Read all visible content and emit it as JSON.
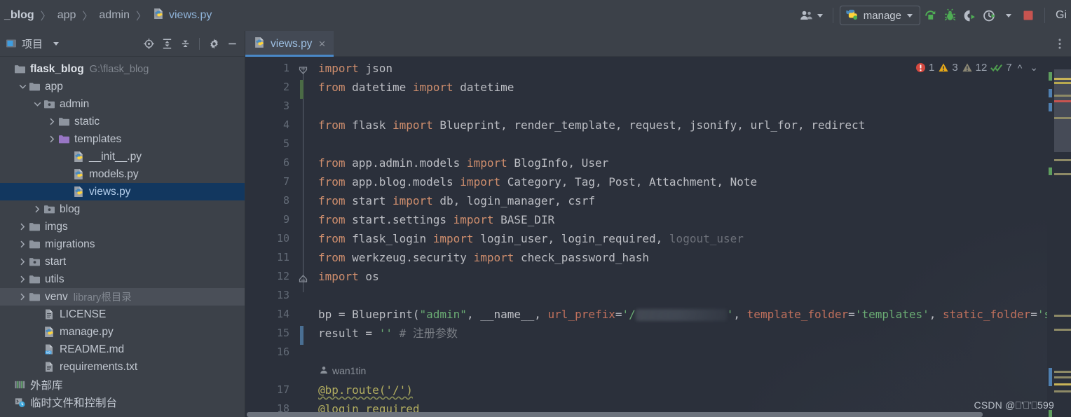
{
  "breadcrumb": {
    "items": [
      {
        "label": "_blog",
        "type": "root"
      },
      {
        "label": "app",
        "type": "dir"
      },
      {
        "label": "admin",
        "type": "dir"
      },
      {
        "label": "views.py",
        "type": "file"
      }
    ],
    "separator": "〉"
  },
  "toolbar": {
    "user_icon": "people-icon",
    "run_config": {
      "label": "manage",
      "icon": "python-icon",
      "caret": "▾"
    },
    "buttons": [
      {
        "name": "run-button",
        "icon": "run-arrow-icon"
      },
      {
        "name": "debug-button",
        "icon": "bug-icon"
      },
      {
        "name": "run-with-coverage-button",
        "icon": "coverage-icon"
      },
      {
        "name": "profile-button",
        "icon": "profile-clock-icon"
      },
      {
        "name": "stop-button",
        "icon": "stop-square-icon"
      }
    ],
    "git_label": "Gi"
  },
  "project_panel": {
    "title": "项目",
    "title_caret": "▾",
    "tools": [
      {
        "name": "select-opened-file-icon",
        "title": "locate"
      },
      {
        "name": "expand-all-icon",
        "title": "expand all"
      },
      {
        "name": "collapse-all-icon",
        "title": "collapse all"
      },
      {
        "name": "gear-icon",
        "title": "settings"
      },
      {
        "name": "hide-panel-icon",
        "title": "hide"
      }
    ]
  },
  "tree": [
    {
      "label": "flask_blog",
      "sub": "G:\\flask_blog",
      "indent": 0,
      "arrow": "none",
      "icon": "folder-icon",
      "state": "root"
    },
    {
      "label": "app",
      "sub": "",
      "indent": 1,
      "arrow": "down",
      "icon": "folder-icon",
      "state": "normal"
    },
    {
      "label": "admin",
      "sub": "",
      "indent": 2,
      "arrow": "down",
      "icon": "package-icon",
      "state": "normal"
    },
    {
      "label": "static",
      "sub": "",
      "indent": 3,
      "arrow": "right",
      "icon": "folder-icon",
      "state": "normal"
    },
    {
      "label": "templates",
      "sub": "",
      "indent": 3,
      "arrow": "right",
      "icon": "templates-folder-icon",
      "state": "normal"
    },
    {
      "label": "__init__.py",
      "sub": "",
      "indent": 4,
      "arrow": "none",
      "icon": "python-file-icon",
      "state": "normal"
    },
    {
      "label": "models.py",
      "sub": "",
      "indent": 4,
      "arrow": "none",
      "icon": "python-file-icon",
      "state": "normal"
    },
    {
      "label": "views.py",
      "sub": "",
      "indent": 4,
      "arrow": "none",
      "icon": "python-file-icon",
      "state": "selected"
    },
    {
      "label": "blog",
      "sub": "",
      "indent": 2,
      "arrow": "right",
      "icon": "package-icon",
      "state": "normal"
    },
    {
      "label": "imgs",
      "sub": "",
      "indent": 1,
      "arrow": "right",
      "icon": "folder-icon",
      "state": "normal"
    },
    {
      "label": "migrations",
      "sub": "",
      "indent": 1,
      "arrow": "right",
      "icon": "folder-icon",
      "state": "normal"
    },
    {
      "label": "start",
      "sub": "",
      "indent": 1,
      "arrow": "right",
      "icon": "package-icon",
      "state": "normal"
    },
    {
      "label": "utils",
      "sub": "",
      "indent": 1,
      "arrow": "right",
      "icon": "folder-icon",
      "state": "normal"
    },
    {
      "label": "venv",
      "sub": "library根目录",
      "indent": 1,
      "arrow": "right",
      "icon": "folder-icon",
      "state": "hovered"
    },
    {
      "label": "LICENSE",
      "sub": "",
      "indent": 2,
      "arrow": "none",
      "icon": "text-file-icon",
      "state": "normal"
    },
    {
      "label": "manage.py",
      "sub": "",
      "indent": 2,
      "arrow": "none",
      "icon": "python-file-icon",
      "state": "normal"
    },
    {
      "label": "README.md",
      "sub": "",
      "indent": 2,
      "arrow": "none",
      "icon": "markdown-file-icon",
      "state": "normal"
    },
    {
      "label": "requirements.txt",
      "sub": "",
      "indent": 2,
      "arrow": "none",
      "icon": "text-file-icon",
      "state": "normal"
    },
    {
      "label": "外部库",
      "sub": "",
      "indent": 0,
      "arrow": "none",
      "icon": "external-libraries-icon",
      "state": "normal"
    },
    {
      "label": "临时文件和控制台",
      "sub": "",
      "indent": 0,
      "arrow": "none",
      "icon": "scratches-icon",
      "state": "normal"
    }
  ],
  "tabs": [
    {
      "label": "views.py",
      "icon": "python-file-icon",
      "close": "×",
      "active": true
    }
  ],
  "tab_more_icon": "more-vertical-icon",
  "inspections": {
    "error_count": "1",
    "warning_count": "3",
    "weak_warning_count": "12",
    "ok_count": "7",
    "prev_icon": "chevron-up-icon",
    "next_icon": "chevron-down-icon"
  },
  "editor": {
    "line_numbers": [
      "1",
      "2",
      "3",
      "4",
      "5",
      "6",
      "7",
      "8",
      "9",
      "10",
      "11",
      "12",
      "13",
      "14",
      "15",
      "16",
      "",
      "17",
      "18"
    ],
    "codelens_author": "wan1tin",
    "codelens_icon": "person-icon"
  },
  "code_lines": [
    {
      "num": "1",
      "tokens": [
        {
          "t": "import",
          "c": "k"
        },
        {
          "t": " json",
          "c": "id"
        }
      ]
    },
    {
      "num": "2",
      "tokens": [
        {
          "t": "from",
          "c": "k"
        },
        {
          "t": " datetime ",
          "c": "id"
        },
        {
          "t": "import",
          "c": "k"
        },
        {
          "t": " datetime",
          "c": "id"
        }
      ]
    },
    {
      "num": "3",
      "tokens": []
    },
    {
      "num": "4",
      "tokens": [
        {
          "t": "from",
          "c": "k"
        },
        {
          "t": " flask ",
          "c": "id"
        },
        {
          "t": "import",
          "c": "k"
        },
        {
          "t": " Blueprint, render_template, request, jsonify, url_for, redirect",
          "c": "id"
        }
      ]
    },
    {
      "num": "5",
      "tokens": []
    },
    {
      "num": "6",
      "tokens": [
        {
          "t": "from",
          "c": "k"
        },
        {
          "t": " app.admin.models ",
          "c": "id"
        },
        {
          "t": "import",
          "c": "k"
        },
        {
          "t": " BlogInfo, User",
          "c": "id"
        }
      ]
    },
    {
      "num": "7",
      "tokens": [
        {
          "t": "from",
          "c": "k"
        },
        {
          "t": " app.blog.models ",
          "c": "id"
        },
        {
          "t": "import",
          "c": "k"
        },
        {
          "t": " Category, Tag, Post, Attachment, Note",
          "c": "id"
        }
      ]
    },
    {
      "num": "8",
      "tokens": [
        {
          "t": "from",
          "c": "k"
        },
        {
          "t": " start ",
          "c": "id"
        },
        {
          "t": "import",
          "c": "k"
        },
        {
          "t": " db, login_manager, csrf",
          "c": "id"
        }
      ]
    },
    {
      "num": "9",
      "tokens": [
        {
          "t": "from",
          "c": "k"
        },
        {
          "t": " start.settings ",
          "c": "id"
        },
        {
          "t": "import",
          "c": "k"
        },
        {
          "t": " BASE_DIR",
          "c": "id"
        }
      ]
    },
    {
      "num": "10",
      "tokens": [
        {
          "t": "from",
          "c": "k"
        },
        {
          "t": " flask_login ",
          "c": "id"
        },
        {
          "t": "import",
          "c": "k"
        },
        {
          "t": " login_user, login_required, ",
          "c": "id"
        },
        {
          "t": "logout_user",
          "c": "dim"
        }
      ]
    },
    {
      "num": "11",
      "tokens": [
        {
          "t": "from",
          "c": "k"
        },
        {
          "t": " werkzeug.security ",
          "c": "id"
        },
        {
          "t": "import",
          "c": "k"
        },
        {
          "t": " check_password_hash",
          "c": "id"
        }
      ]
    },
    {
      "num": "12",
      "tokens": [
        {
          "t": "import",
          "c": "k"
        },
        {
          "t": " os",
          "c": "id"
        }
      ]
    },
    {
      "num": "13",
      "tokens": []
    },
    {
      "num": "14",
      "tokens": [
        {
          "t": "bp = Blueprint(",
          "c": "id"
        },
        {
          "t": "\"admin\"",
          "c": "s"
        },
        {
          "t": ", __name__, ",
          "c": "id"
        },
        {
          "t": "url_prefix",
          "c": "param"
        },
        {
          "t": "=",
          "c": "id"
        },
        {
          "t": "'/",
          "c": "s"
        },
        {
          "t": "__BLUR__",
          "c": "blur"
        },
        {
          "t": "'",
          "c": "s"
        },
        {
          "t": ", ",
          "c": "id"
        },
        {
          "t": "template_folder",
          "c": "param"
        },
        {
          "t": "=",
          "c": "id"
        },
        {
          "t": "'templates'",
          "c": "s"
        },
        {
          "t": ", ",
          "c": "id"
        },
        {
          "t": "static_folder",
          "c": "param"
        },
        {
          "t": "=",
          "c": "id"
        },
        {
          "t": "'stat",
          "c": "s"
        }
      ]
    },
    {
      "num": "15",
      "tokens": [
        {
          "t": "result = ",
          "c": "id"
        },
        {
          "t": "''",
          "c": "s"
        },
        {
          "t": "  # 注册参数",
          "c": "cm"
        }
      ]
    },
    {
      "num": "16",
      "tokens": []
    },
    {
      "num": "17",
      "tokens": [
        {
          "t": "@bp.route('/')",
          "c": "dec wavy"
        }
      ]
    },
    {
      "num": "18",
      "tokens": [
        {
          "t": "@login_required",
          "c": "dec"
        }
      ]
    }
  ],
  "watermark": "CSDN @⎕'⎕'⎕599",
  "colors": {
    "bg_chrome": "#3c4149",
    "bg_editor": "#2b303b",
    "selection": "#12375f",
    "accent_tab": "#4a88c7",
    "keyword": "#cf8e6d",
    "string": "#6aab73",
    "identifier": "#bcbec4",
    "comment": "#7a7e85",
    "decorator": "#b3ae60",
    "named_arg": "#c0705c",
    "error": "#d4483f",
    "warning": "#e6a817",
    "ok": "#4f9e4f"
  }
}
